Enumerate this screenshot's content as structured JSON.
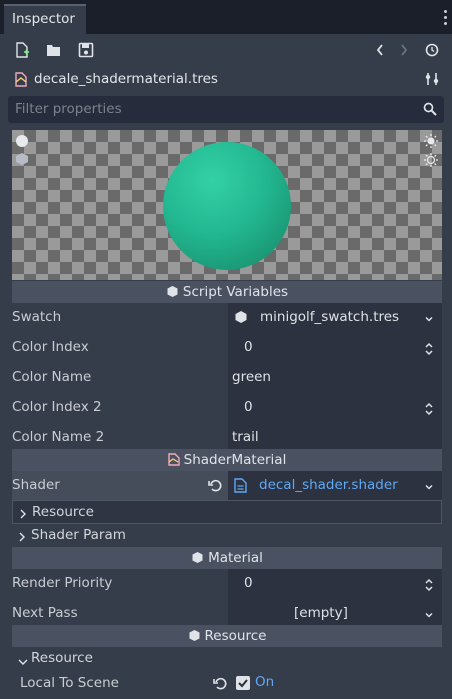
{
  "tab": {
    "title": "Inspector"
  },
  "resource": {
    "filename": "decale_shadermaterial.tres"
  },
  "filter": {
    "placeholder": "Filter properties"
  },
  "sections": {
    "script_variables": "Script Variables",
    "shader_material": "ShaderMaterial",
    "material": "Material",
    "resource": "Resource"
  },
  "props": {
    "swatch": {
      "label": "Swatch",
      "value": "minigolf_swatch.tres"
    },
    "color_index": {
      "label": "Color Index",
      "value": "0"
    },
    "color_name": {
      "label": "Color Name",
      "value": "green"
    },
    "color_index_2": {
      "label": "Color Index 2",
      "value": "0"
    },
    "color_name_2": {
      "label": "Color Name 2",
      "value": "trail"
    },
    "shader": {
      "label": "Shader",
      "value": "decal_shader.shader"
    },
    "render_priority": {
      "label": "Render Priority",
      "value": "0"
    },
    "next_pass": {
      "label": "Next Pass",
      "value": "[empty]"
    },
    "local_to_scene": {
      "label": "Local To Scene",
      "value": "On"
    }
  },
  "subgroups": {
    "resource": "Resource",
    "shader_param": "Shader Param",
    "resource2": "Resource"
  },
  "colors": {
    "accent": "#5fa8f3",
    "sphere": "#22b790",
    "bg": "#363d4a"
  }
}
